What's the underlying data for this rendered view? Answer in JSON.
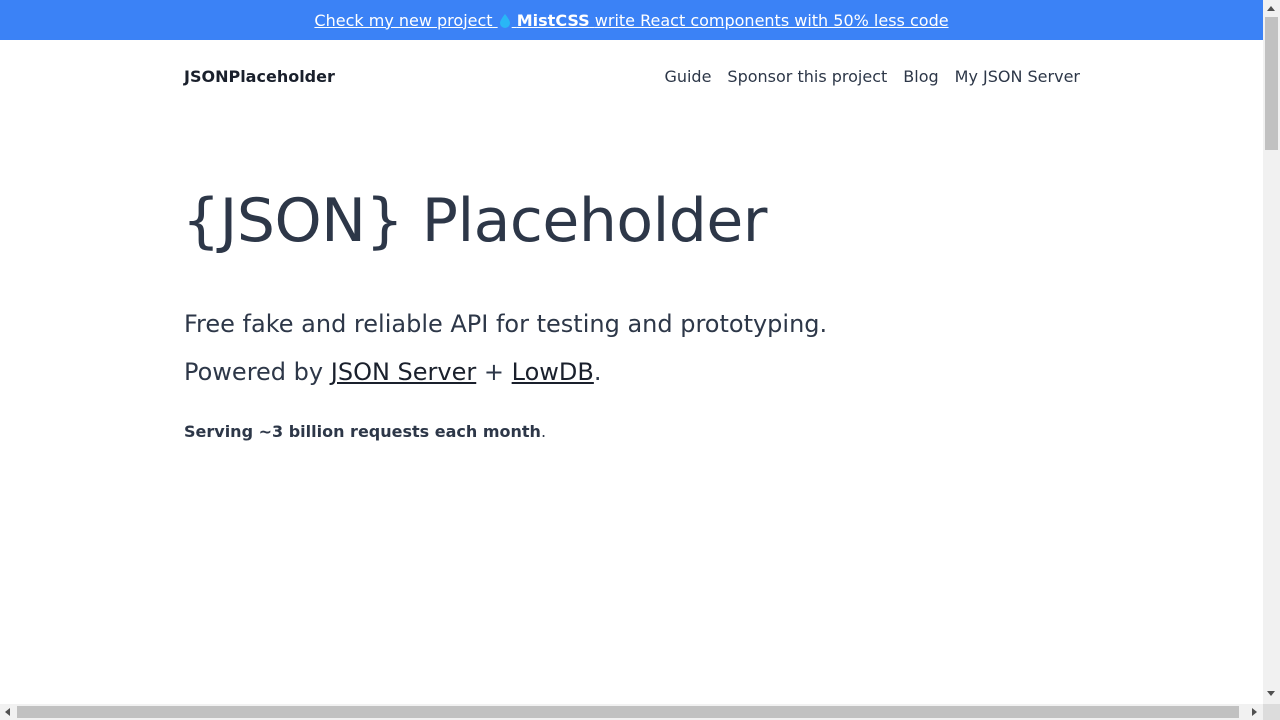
{
  "banner": {
    "prefix": "Check my new project",
    "icon": "droplet-icon",
    "product": "MistCSS",
    "suffix": "write React components with 50% less code",
    "background": "#3b82f6"
  },
  "nav": {
    "brand": "JSONPlaceholder",
    "links": [
      "Guide",
      "Sponsor this project",
      "Blog",
      "My JSON Server"
    ]
  },
  "hero": {
    "title": "{JSON} Placeholder",
    "tagline": "Free fake and reliable API for testing and prototyping.",
    "powered_prefix": "Powered by",
    "powered_link1": "JSON Server",
    "powered_plus": "+",
    "powered_link2": "LowDB",
    "powered_end": ".",
    "stats_bold": "Serving ~3 billion requests each month",
    "stats_end": "."
  }
}
